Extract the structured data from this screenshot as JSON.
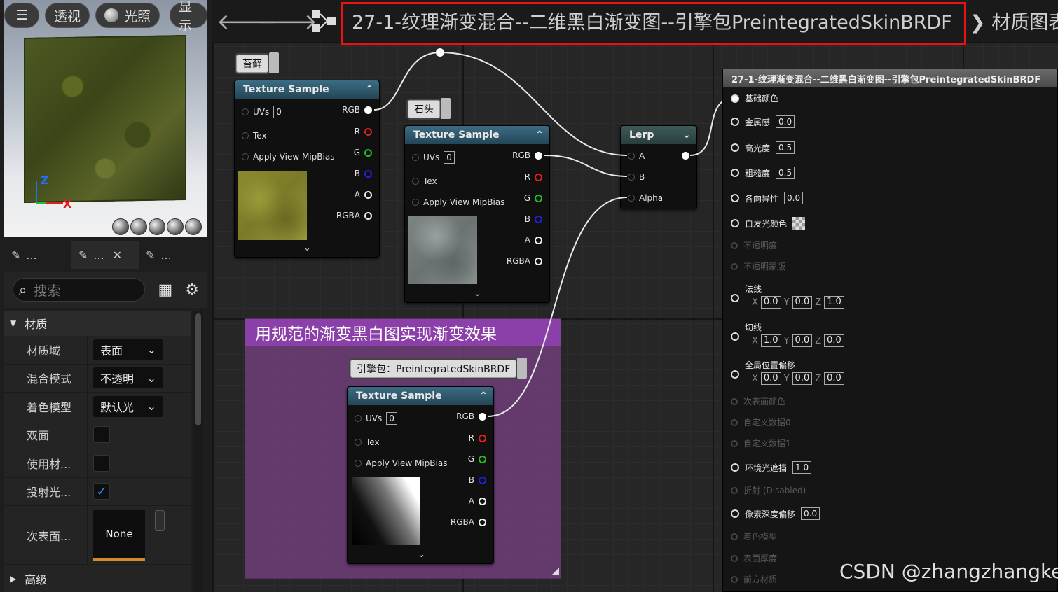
{
  "viewport": {
    "buttons": [
      {
        "label": "透视",
        "icon": "perspective-icon"
      },
      {
        "label": "光照",
        "icon": "lit-icon"
      },
      {
        "label": "显示",
        "icon": "show-icon"
      }
    ],
    "axes": {
      "x": "X",
      "z": "Z"
    }
  },
  "panel": {
    "tabs": [
      "...",
      "...",
      "..."
    ],
    "search_placeholder": "搜索",
    "category_main": "材质",
    "category_adv": "高级",
    "properties": [
      {
        "label": "材质域",
        "type": "dropdown",
        "value": "表面"
      },
      {
        "label": "混合模式",
        "type": "dropdown",
        "value": "不透明"
      },
      {
        "label": "着色模型",
        "type": "dropdown",
        "value": "默认光"
      },
      {
        "label": "双面",
        "type": "checkbox",
        "checked": false
      },
      {
        "label": "使用材...",
        "type": "checkbox",
        "checked": false
      },
      {
        "label": "投射光...",
        "type": "checkbox",
        "checked": true
      },
      {
        "label": "次表面...",
        "type": "asset",
        "value": "None"
      }
    ]
  },
  "toolbar": {
    "breadcrumb_title": "27-1-纹理渐变混合--二维黑白渐变图--引擎包PreintegratedSkinBRDF",
    "breadcrumb_next": "材质图表",
    "accent": "#e11111"
  },
  "graph": {
    "comment": {
      "title": "用规范的渐变黑白图实现渐变效果",
      "color": "#8b3fa8"
    },
    "tags": {
      "moss": "苔藓",
      "stone": "石头",
      "engine": "引擎包：PreintegratedSkinBRDF"
    },
    "texture_node": {
      "title": "Texture Sample",
      "inputs": {
        "uvs": "UVs",
        "uvs_value": "0",
        "tex": "Tex",
        "mip": "Apply View MipBias"
      },
      "outputs": {
        "rgb": "RGB",
        "r": "R",
        "g": "G",
        "b": "B",
        "a": "A",
        "rgba": "RGBA"
      }
    },
    "lerp": {
      "title": "Lerp",
      "a": "A",
      "b": "B",
      "alpha": "Alpha"
    },
    "result": {
      "title": "27-1-纹理渐变混合--二维黑白渐变图--引擎包PreintegratedSkinBRDF",
      "pins": [
        {
          "label": "基础颜色",
          "active": true,
          "filled": true
        },
        {
          "label": "金属感",
          "active": true,
          "value": "0.0"
        },
        {
          "label": "高光度",
          "active": true,
          "value": "0.5"
        },
        {
          "label": "粗糙度",
          "active": true,
          "value": "0.5"
        },
        {
          "label": "各向异性",
          "active": true,
          "value": "0.0"
        },
        {
          "label": "自发光颜色",
          "active": true,
          "swatch": true
        },
        {
          "label": "不透明度",
          "active": false
        },
        {
          "label": "不透明蒙版",
          "active": false
        },
        {
          "label": "法线",
          "active": true,
          "vector": [
            "0.0",
            "0.0",
            "1.0"
          ]
        },
        {
          "label": "切线",
          "active": true,
          "vector": [
            "1.0",
            "0.0",
            "0.0"
          ]
        },
        {
          "label": "全局位置偏移",
          "active": true,
          "vector": [
            "0.0",
            "0.0",
            "0.0"
          ]
        },
        {
          "label": "次表面颜色",
          "active": false
        },
        {
          "label": "自定义数据0",
          "active": false
        },
        {
          "label": "自定义数据1",
          "active": false
        },
        {
          "label": "环境光遮挡",
          "active": true,
          "value": "1.0"
        },
        {
          "label": "折射 (Disabled)",
          "active": false
        },
        {
          "label": "像素深度偏移",
          "active": true,
          "value": "0.0"
        },
        {
          "label": "着色模型",
          "active": false
        },
        {
          "label": "表面厚度",
          "active": false
        },
        {
          "label": "前方材质",
          "active": false
        }
      ],
      "axis_labels": [
        "X",
        "Y",
        "Z"
      ]
    }
  },
  "watermark": "CSDN @zhangzhangkeji"
}
